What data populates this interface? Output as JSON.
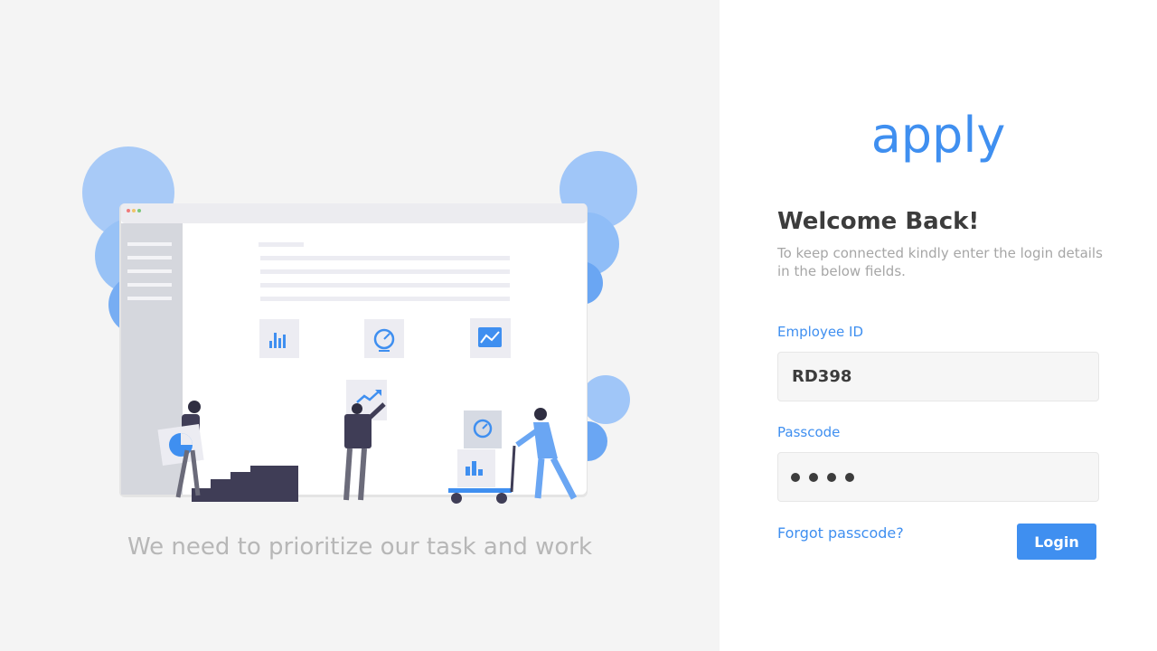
{
  "brand": {
    "logo_text": "apply",
    "accent_color": "#3f8ff0"
  },
  "left": {
    "tagline": "We need to prioritize our task and work"
  },
  "login": {
    "title": "Welcome Back!",
    "subtitle": "To keep connected kindly enter the login details in the below fields.",
    "employee_id": {
      "label": "Employee ID",
      "value": "RD398"
    },
    "passcode": {
      "label": "Passcode",
      "masked_length": 4
    },
    "forgot_label": "Forgot passcode?",
    "submit_label": "Login"
  },
  "illustration": {
    "icons": [
      "bar-chart-icon",
      "speedometer-icon",
      "line-chart-icon",
      "trend-up-icon",
      "pie-chart-icon"
    ]
  }
}
